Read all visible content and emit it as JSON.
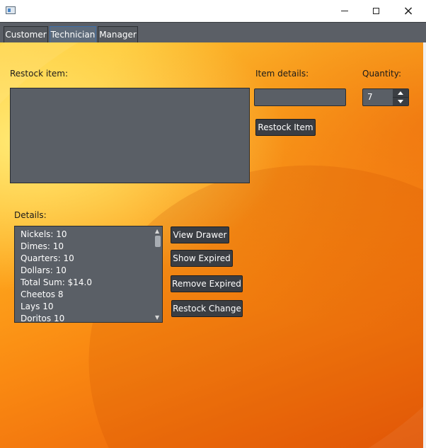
{
  "window": {
    "icon": "app-window-icon",
    "controls": {
      "minimize": "minimize-icon",
      "maximize": "maximize-icon",
      "close": "×"
    }
  },
  "tabs": [
    {
      "label": "Customer",
      "selected": false
    },
    {
      "label": "Technician",
      "selected": true
    },
    {
      "label": "Manager",
      "selected": false
    }
  ],
  "restock": {
    "label": "Restock item:",
    "item_details_label": "Item details:",
    "item_details_value": "",
    "quantity_label": "Quantity:",
    "quantity_value": "7",
    "restock_button": "Restock Item"
  },
  "details": {
    "label": "Details:",
    "lines": [
      "Nickels: 10",
      "Dimes: 10",
      "Quarters: 10",
      "Dollars: 10",
      "Total Sum: $14.0",
      "Cheetos 8",
      "Lays 10",
      "Doritos 10"
    ]
  },
  "buttons": {
    "view_drawer": "View Drawer",
    "show_expired": "Show Expired",
    "remove_expired": "Remove Expired",
    "restock_change": "Restock Change"
  },
  "colors": {
    "panel": "#5a5f66",
    "button": "#3b3e43",
    "accent_tab": "#3d6ea8",
    "background_top": "#ffce3a",
    "background_bottom": "#e85a08"
  }
}
